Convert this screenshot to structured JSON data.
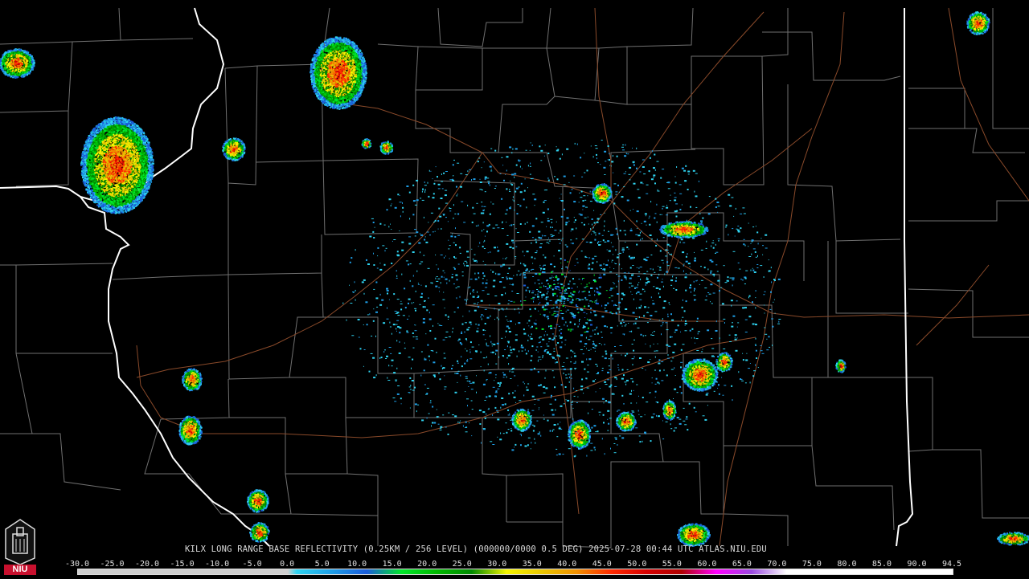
{
  "product": {
    "caption": "KILX LONG RANGE BASE REFLECTIVITY (0.25KM / 256 LEVEL) (000000/0000 0.5 DEG) 2025-07-28 00:44 UTC  ATLAS.NIU.EDU"
  },
  "logo": {
    "text": "NIU"
  },
  "scale": {
    "labels": [
      "-30.0",
      "-25.0",
      "-20.0",
      "-15.0",
      "-10.0",
      "-5.0",
      "0.0",
      "5.0",
      "10.0",
      "15.0",
      "20.0",
      "25.0",
      "30.0",
      "35.0",
      "40.0",
      "45.0",
      "50.0",
      "55.0",
      "60.0",
      "65.0",
      "70.0",
      "75.0",
      "80.0",
      "85.0",
      "90.0",
      "94.5"
    ],
    "colors": {
      "below0": "#cfcfcf",
      "5": "#2fd3f0",
      "10": "#1e9ee6",
      "15": "#1a5cdb",
      "20": "#00e52a",
      "25": "#00b800",
      "30": "#008a00",
      "35": "#f5f500",
      "40": "#e8c600",
      "45": "#f09000",
      "50": "#ff2a00",
      "55": "#d60000",
      "60": "#b00000",
      "65": "#ff00ff",
      "70": "#9a4ae0",
      "75": "#ffffff"
    }
  },
  "colors": {
    "county_lines": "#7a7a7a",
    "state_lines": "#ffffff",
    "roads": "#8a4a2a",
    "background": "#000000"
  }
}
